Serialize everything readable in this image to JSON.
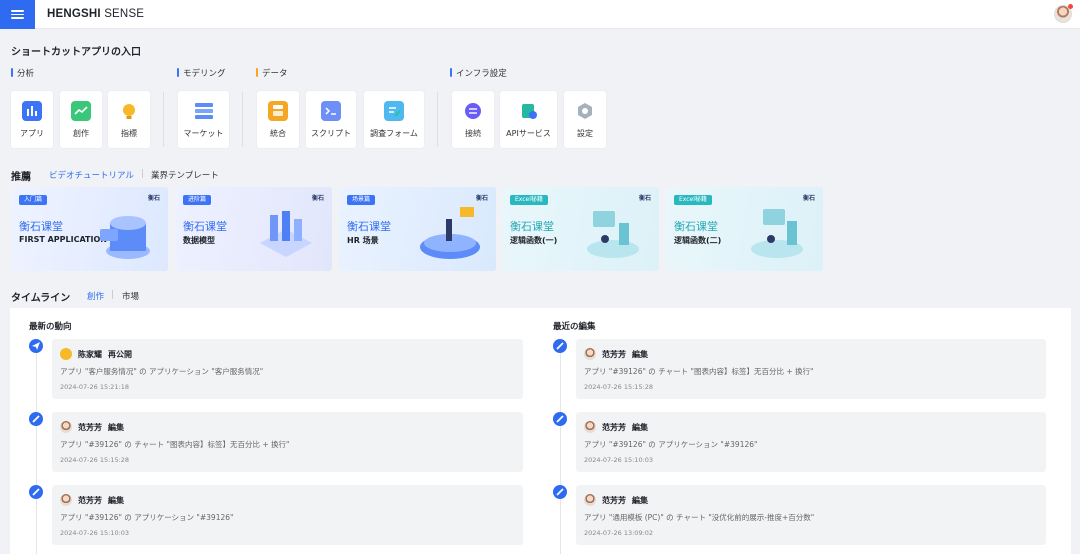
{
  "header": {
    "brand_bold": "HENGSHI",
    "brand_rest": " SENSE"
  },
  "shortcuts": {
    "title": "ショートカットアプリの入口",
    "groups": [
      {
        "label": "分析",
        "items": [
          "アプリ",
          "創作",
          "指標"
        ]
      },
      {
        "label": "モデリング",
        "items": [
          "マーケット"
        ]
      },
      {
        "label": "データ",
        "items": [
          "統合",
          "スクリプト",
          "調査フォーム"
        ]
      },
      {
        "label": "インフラ設定",
        "items": [
          "接続",
          "APIサービス",
          "設定"
        ]
      }
    ]
  },
  "recommend": {
    "title": "推薦",
    "tabs": [
      "ビデオチュートリアル",
      "業界テンプレート"
    ],
    "banners": [
      {
        "tag": "入门篇",
        "logo": "衡石",
        "title": "衡石课堂",
        "sub": "FIRST APPLICATION"
      },
      {
        "tag": "进阶篇",
        "logo": "衡石",
        "title": "衡石课堂",
        "sub": "数据模型"
      },
      {
        "tag": "场景篇",
        "logo": "衡石",
        "title": "衡石课堂",
        "sub": "HR 场景"
      },
      {
        "tag": "Excel秘籍",
        "logo": "衡石",
        "title": "衡石课堂",
        "sub": "逻辑函数(一)"
      },
      {
        "tag": "Excel秘籍",
        "logo": "衡石",
        "title": "衡石课堂",
        "sub": "逻辑函数(二)"
      }
    ]
  },
  "timeline": {
    "title": "タイムライン",
    "tabs": [
      "創作",
      "市場"
    ],
    "left": {
      "title": "最新の動向",
      "items": [
        {
          "user": "陈家耀",
          "action": "再公開",
          "desc": "アプリ \"客户服务情况\" の アプリケーション \"客户服务情况\"",
          "time": "2024-07-26 15:21:18"
        },
        {
          "user": "范芳芳",
          "action": "編集",
          "desc": "アプリ \"#39126\" の チャート \"图表内容】标签】无百分比 + 换行\"",
          "time": "2024-07-26 15:15:28"
        },
        {
          "user": "范芳芳",
          "action": "編集",
          "desc": "アプリ \"#39126\" の アプリケーション \"#39126\"",
          "time": "2024-07-26 15:10:03"
        }
      ]
    },
    "right": {
      "title": "最近の編集",
      "items": [
        {
          "user": "范芳芳",
          "action": "編集",
          "desc": "アプリ \"#39126\" の チャート \"图表内容】标签】无百分比 + 换行\"",
          "time": "2024-07-26 15:15:28"
        },
        {
          "user": "范芳芳",
          "action": "編集",
          "desc": "アプリ \"#39126\" の アプリケーション \"#39126\"",
          "time": "2024-07-26 15:10:03"
        },
        {
          "user": "范芳芳",
          "action": "編集",
          "desc": "アプリ \"通用模板 (PC)\" の チャート \"没优化前的展示-推度+百分数\"",
          "time": "2024-07-26 13:09:02"
        }
      ]
    }
  },
  "colors": {
    "accent": "#2f6bf0",
    "background": "#f0f2f5",
    "card": "#f2f3f5"
  }
}
